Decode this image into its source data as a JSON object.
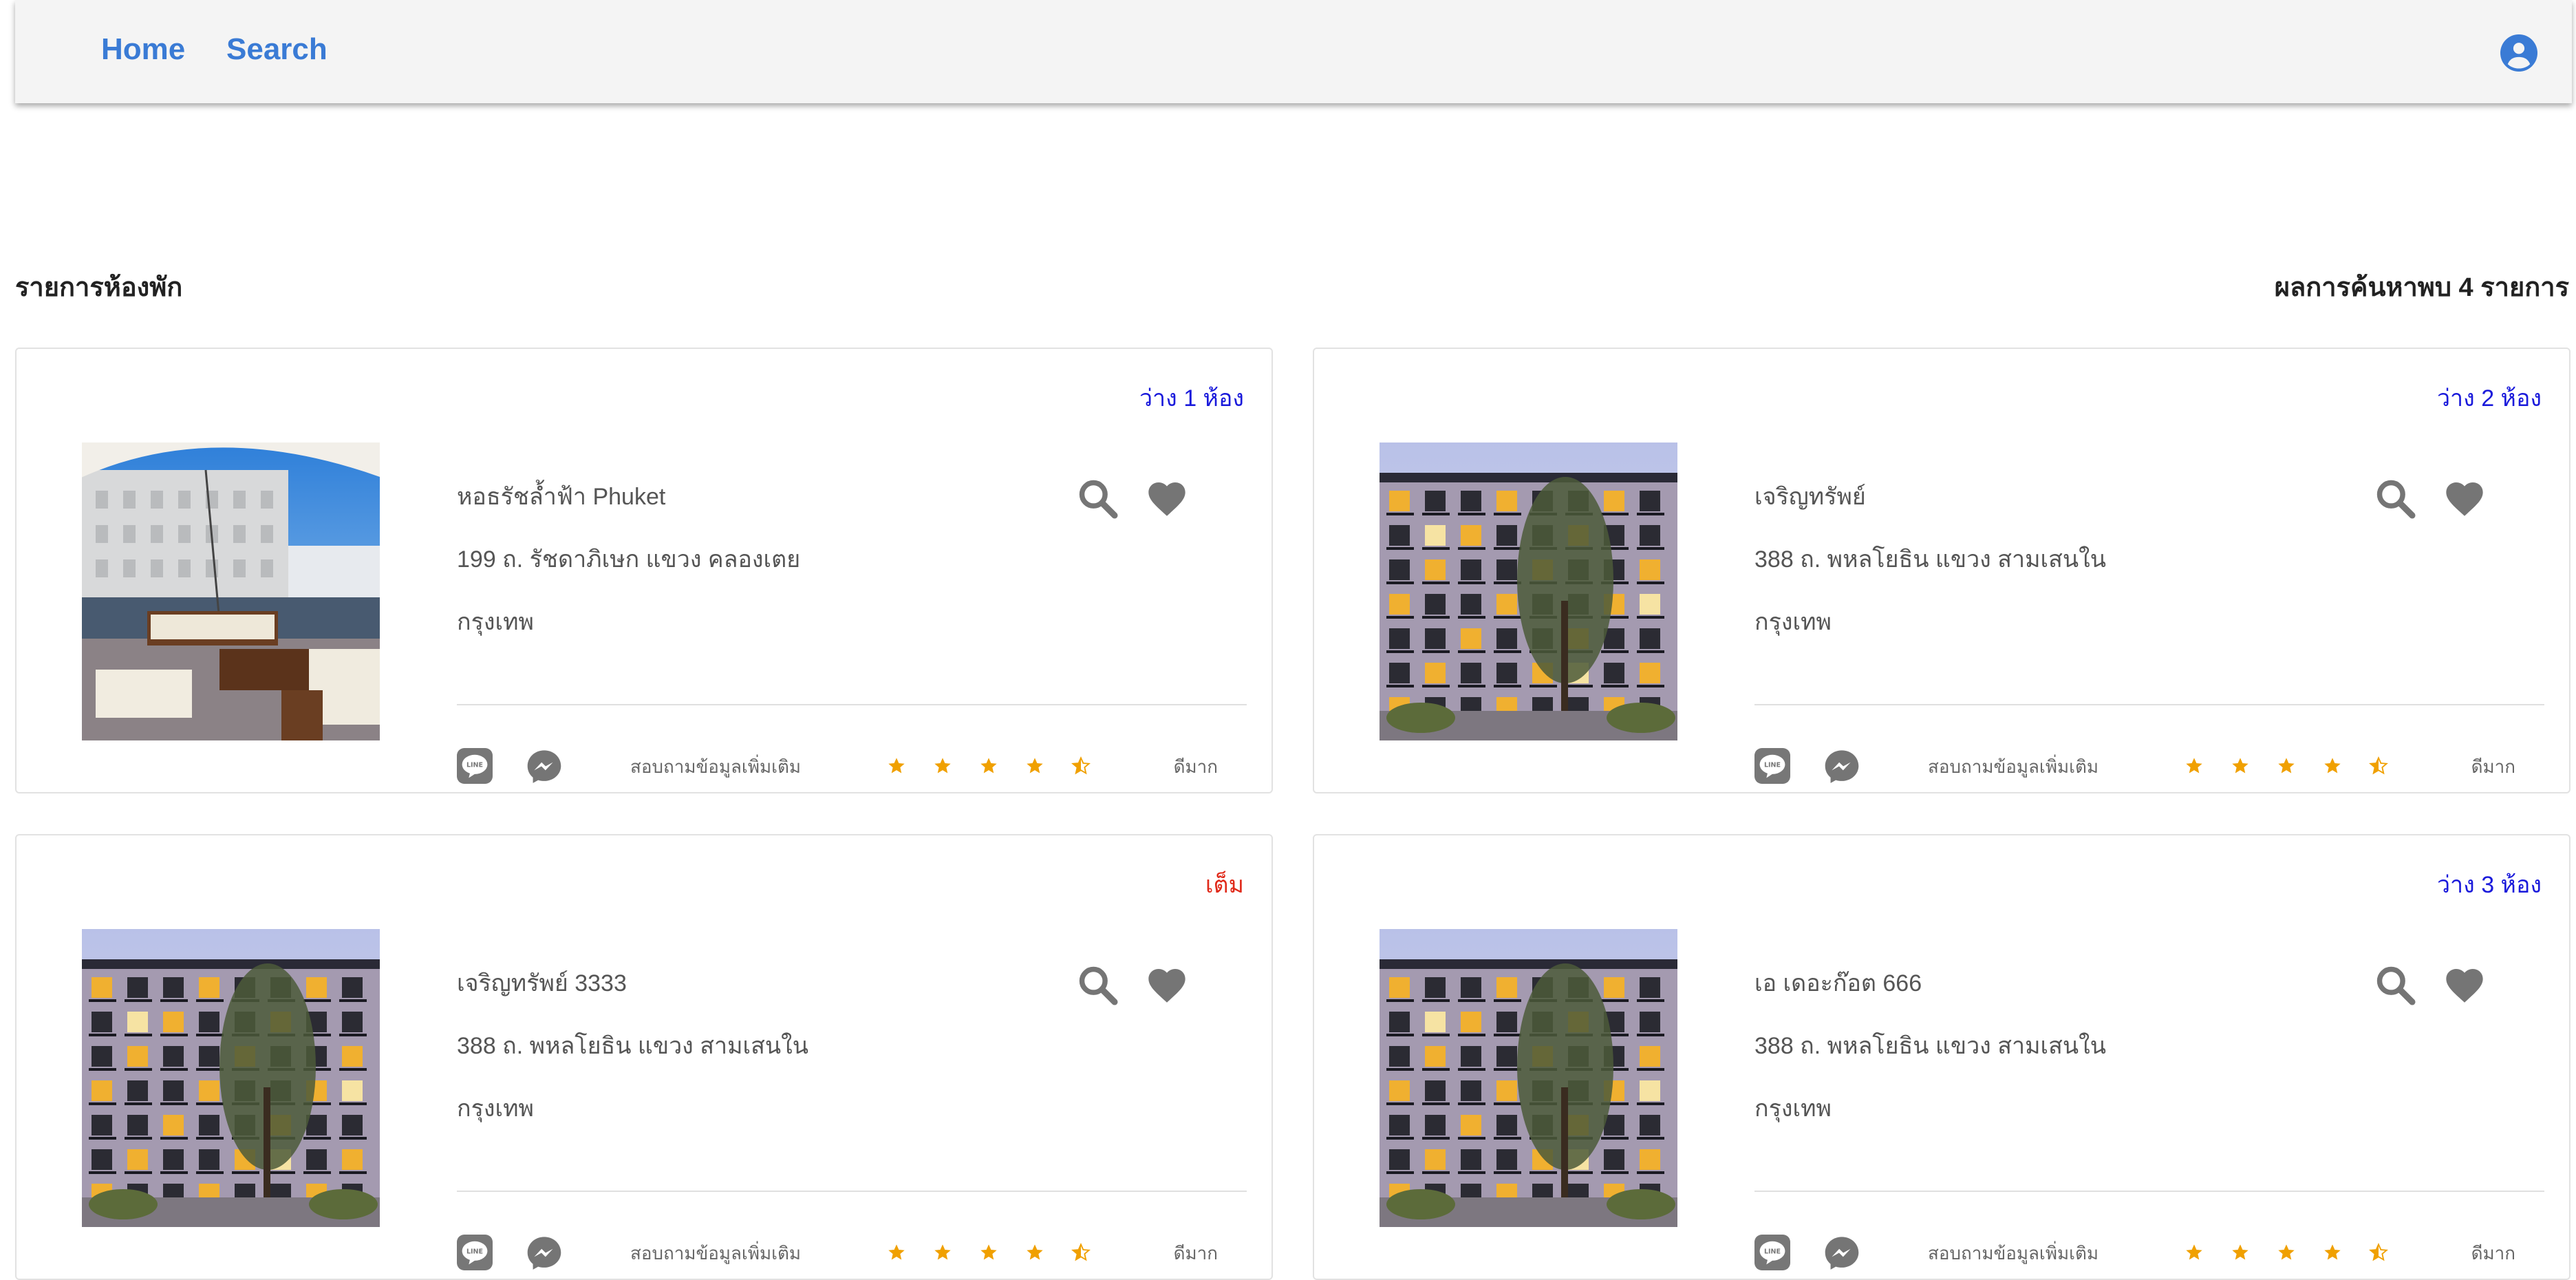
{
  "nav": {
    "home_label": "Home",
    "search_label": "Search",
    "link_color": "#3a7bd5"
  },
  "header": {
    "section_title": "รายการห้องพัก",
    "result_count": "ผลการค้นหาพบ 4 รายการ"
  },
  "colors": {
    "available": "#1a1adb",
    "full": "#e02a1a",
    "star": "#f0a000",
    "icon_gray": "#757575"
  },
  "listings": [
    {
      "status": "ว่าง 1 ห้อง",
      "status_type": "available",
      "name": "หอธรัชล้ำฟ้า Phuket",
      "address": "199 ถ. รัชดาภิเษก แขวง คลองเตย",
      "city": "กรุงเทพ",
      "photo": "rooftop-terrace",
      "inquire": "สอบถามข้อมูลเพิ่มเติม",
      "rating": 4.5,
      "rating_text": "ดีมาก"
    },
    {
      "status": "ว่าง 2 ห้อง",
      "status_type": "available",
      "name": "เจริญทรัพย์",
      "address": "388 ถ. พหลโยธิน แขวง สามเสนใน",
      "city": "กรุงเทพ",
      "photo": "apartment-building",
      "inquire": "สอบถามข้อมูลเพิ่มเติม",
      "rating": 4.5,
      "rating_text": "ดีมาก"
    },
    {
      "status": "เต็ม",
      "status_type": "full",
      "name": "เจริญทรัพย์ 3333",
      "address": "388 ถ. พหลโยธิน แขวง สามเสนใน",
      "city": "กรุงเทพ",
      "photo": "apartment-building",
      "inquire": "สอบถามข้อมูลเพิ่มเติม",
      "rating": 4.5,
      "rating_text": "ดีมาก"
    },
    {
      "status": "ว่าง 3 ห้อง",
      "status_type": "available",
      "name": "เอ เดอะก๊อต 666",
      "address": "388 ถ. พหลโยธิน แขวง สามเสนใน",
      "city": "กรุงเทพ",
      "photo": "apartment-building",
      "inquire": "สอบถามข้อมูลเพิ่มเติม",
      "rating": 4.5,
      "rating_text": "ดีมาก"
    }
  ],
  "icons": {
    "account": "account-circle-icon",
    "search": "magnifier-icon",
    "favorite": "heart-icon",
    "line": "line-app-icon",
    "messenger": "messenger-icon",
    "star": "star-icon"
  }
}
